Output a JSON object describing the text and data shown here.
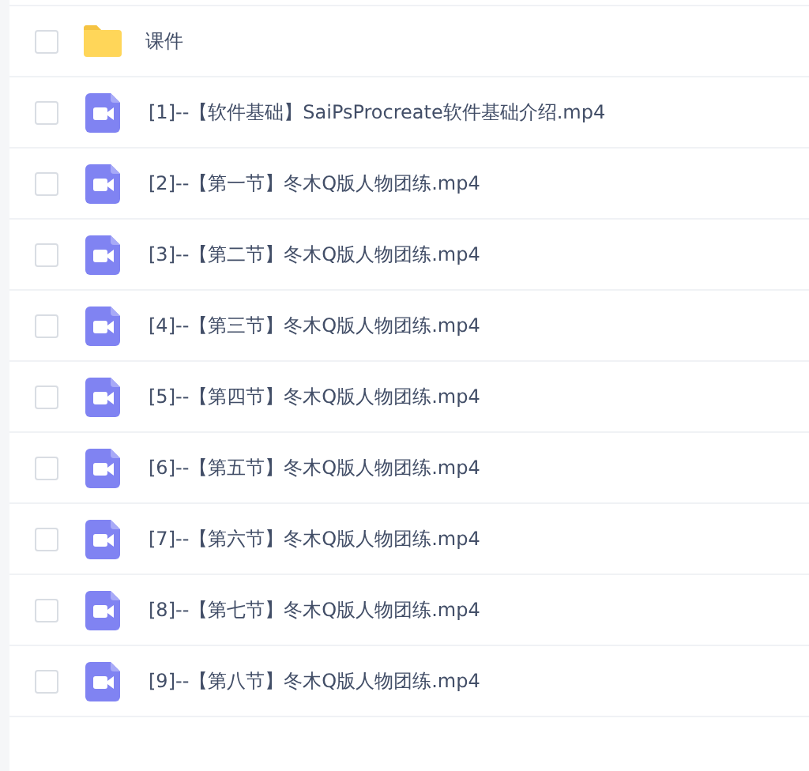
{
  "files": [
    {
      "kind": "folder",
      "name": "课件",
      "checked": false
    },
    {
      "kind": "video",
      "name": "[1]--【软件基础】SaiPsProcreate软件基础介绍.mp4",
      "checked": false
    },
    {
      "kind": "video",
      "name": "[2]--【第一节】冬木Q版人物团练.mp4",
      "checked": false
    },
    {
      "kind": "video",
      "name": "[3]--【第二节】冬木Q版人物团练.mp4",
      "checked": false
    },
    {
      "kind": "video",
      "name": "[4]--【第三节】冬木Q版人物团练.mp4",
      "checked": false
    },
    {
      "kind": "video",
      "name": "[5]--【第四节】冬木Q版人物团练.mp4",
      "checked": false
    },
    {
      "kind": "video",
      "name": "[6]--【第五节】冬木Q版人物团练.mp4",
      "checked": false
    },
    {
      "kind": "video",
      "name": "[7]--【第六节】冬木Q版人物团练.mp4",
      "checked": false
    },
    {
      "kind": "video",
      "name": "[8]--【第七节】冬木Q版人物团练.mp4",
      "checked": false
    },
    {
      "kind": "video",
      "name": "[9]--【第八节】冬木Q版人物团练.mp4",
      "checked": false
    }
  ]
}
